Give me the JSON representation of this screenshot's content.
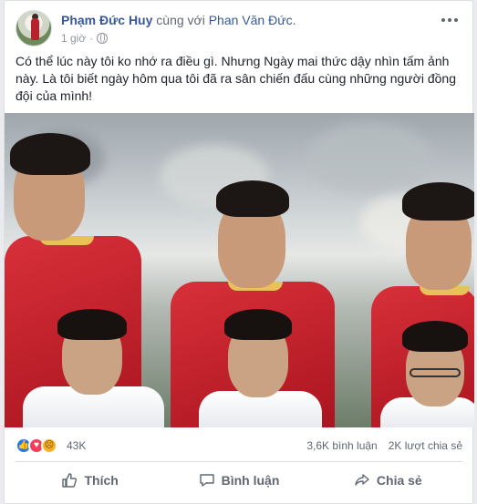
{
  "post": {
    "author": "Phạm Đức Huy",
    "with_text": "cùng với",
    "tagged_friend": "Phan Văn Đức.",
    "time": "1 giờ",
    "separator": "·",
    "privacy_icon": "globe-icon",
    "menu_icon": "more-options-icon",
    "text": "Có thể lúc này tôi ko nhớ ra điều gì. Nhưng Ngày mai thức dậy nhìn tấm ảnh này. Là tôi biết ngày hôm qua tôi đã ra sân chiến đấu cùng những người đồng đội của mình!"
  },
  "reactions": {
    "icons": [
      "like-icon",
      "love-icon",
      "sad-icon"
    ],
    "count": "43K",
    "comments": "3,6K bình luận",
    "shares": "2K lượt chia sẻ"
  },
  "actions": {
    "like_label": "Thích",
    "comment_label": "Bình luận",
    "share_label": "Chia sẻ"
  },
  "colors": {
    "link": "#385898",
    "secondary_text": "#606770",
    "like_blue": "#2078f4",
    "love_red": "#f33e58",
    "sad_yellow": "#f7b125"
  }
}
